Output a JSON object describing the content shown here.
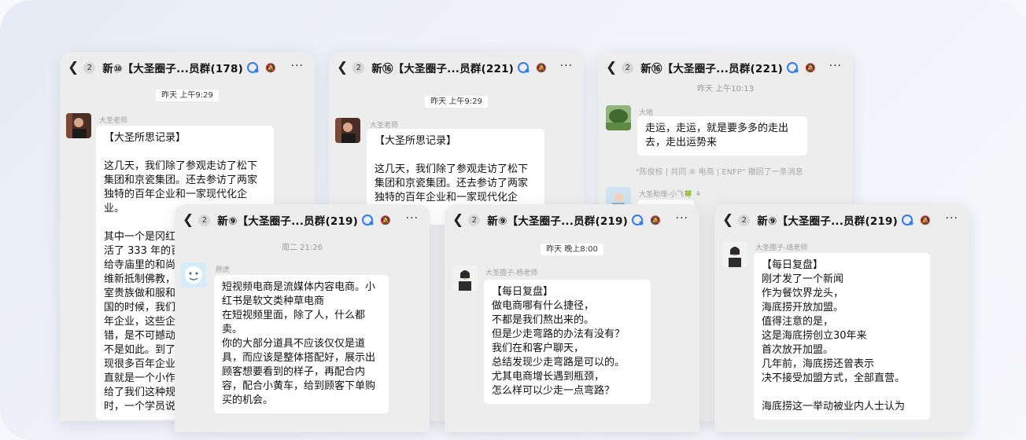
{
  "accent_color": "#1aad19",
  "panels": [
    {
      "back_count": "2",
      "title": "新⑩【大圣圈子...员群(178)",
      "timestamp": "昨天 上午9:29",
      "sender": "大圣老师",
      "message": "【大圣所思记录】\n\n这几天，我们除了参观走访了松下集团和京瓷集团。还去参访了两家独特的百年企业和一家现代化企业。\n\n其中一个是冈红\n活了 333 年的百\n给寺庙里的和尚\n维新抵制佛教，\n室贵族做和服和\n国的时候，我们\n年企业，这些企\n错，是不可撼动\n不是如此。到了\n现很多百年企业\n直就是一个小作\n给了我们这种规\n时，一个学员说"
    },
    {
      "back_count": "2",
      "title": "新⑯【大圣圈子...员群(221)",
      "timestamp": "昨天 上午9:29",
      "sender": "大圣老师",
      "message": "【大圣所思记录】\n\n这几天，我们除了参观走访了松下集团和京瓷集团。还去参访了两家独特的百年企业和一家现代化企业。"
    },
    {
      "back_count": "2",
      "title": "新⑯【大圣圈子...员群(221)",
      "timestamp": "昨天 上午10:13",
      "sender": "大地",
      "message": "走运，走运，就是要多多的走出去，走出运势来",
      "recall_notice": "\"陈俊标 | 共同 ⑧ 电商 | ENFP\" 撤回了一条消息",
      "sender2": "大圣助理-小飞🍀 ⚘"
    },
    {
      "back_count": "2",
      "title": "新⑨【大圣圈子...员群(219)",
      "timestamp": "周二 21:26",
      "sender": "胖虎",
      "message": "短视频电商是流媒体内容电商。小红书是软文类种草电商\n在短视频里面，除了人，什么都卖。\n你的大部分道具不应该仅仅是道具，而应该是整体搭配好，展示出顾客想要看到的样子，再配合内容，配合小黄车，给到顾客下单购买的机会。"
    },
    {
      "back_count": "2",
      "title": "新⑨【大圣圈子...员群(219)",
      "timestamp": "昨天 晚上8:00",
      "sender": "大圣圈子-杨老师",
      "message": "【每日复盘】\n做电商哪有什么捷径，\n不都是我们熬出来的。\n但是少走弯路的办法有没有？\n我们在和客户聊天，\n总结发现少走弯路是可以的。\n尤其电商增长遇到瓶颈，\n怎么样可以少走一点弯路？"
    },
    {
      "back_count": "2",
      "title": "新⑨【大圣圈子...员群(219)",
      "sender": "大圣圈子-靖老师",
      "message": "【每日复盘】\n刚才发了一个新闻\n作为餐饮界龙头，\n海底捞开放加盟。\n值得注意的是，\n这是海底捞创立30年来\n首次放开加盟。\n几年前，海底捞还曾表示\n决不接受加盟方式，全部直营。\n\n海底捞这一举动被业内人士认为"
    }
  ]
}
